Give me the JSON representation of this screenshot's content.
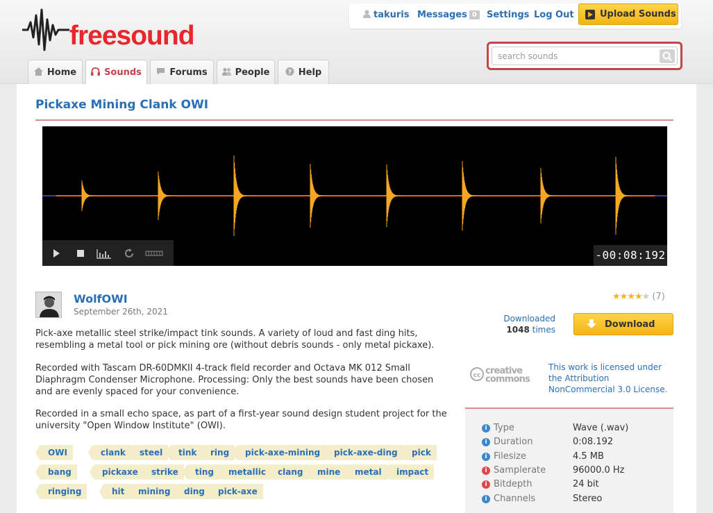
{
  "brand": {
    "name": "freesound",
    "accent": "#e8262c",
    "link_color": "#2a6fb5"
  },
  "user_bar": {
    "username": "takuris",
    "messages_label": "Messages",
    "messages_count": "0",
    "settings_label": "Settings",
    "logout_label": "Log Out",
    "upload_label": "Upload Sounds"
  },
  "search": {
    "placeholder": "search sounds",
    "value": ""
  },
  "nav": {
    "tabs": [
      {
        "label": "Home",
        "icon": "home-icon"
      },
      {
        "label": "Sounds",
        "icon": "headphones-icon",
        "active": true
      },
      {
        "label": "Forums",
        "icon": "speech-bubble-icon"
      },
      {
        "label": "People",
        "icon": "people-icon"
      },
      {
        "label": "Help",
        "icon": "help-icon"
      }
    ]
  },
  "sound": {
    "title": "Pickaxe Mining Clank OWI",
    "player": {
      "time": "-00:08:192"
    },
    "author": "WolfOWI",
    "date": "September 26th, 2021",
    "description": [
      "Pick-axe metallic steel strike/impact tink sounds. A variety of loud and fast ding hits, resembling a metal tool or pick mining ore (without debris sounds - only metal pickaxe).",
      "Recorded with Tascam DR-60DMKII 4-track field recorder and Octava MK 012 Small Diaphragm Condenser Microphone. Processing: Only the best sounds have been chosen and are evenly spaced for your convenience.",
      "Recorded in a small echo space, as part of a first-year sound design student project for the university \"Open Window Institute\" (OWI)."
    ],
    "tags": [
      "OWI",
      "clank",
      "steel",
      "tink",
      "ring",
      "pick-axe-mining",
      "pick-axe-ding",
      "pick",
      "bang",
      "pickaxe",
      "strike",
      "ting",
      "metallic",
      "clang",
      "mine",
      "metal",
      "impact",
      "ringing",
      "hit",
      "mining",
      "ding",
      "pick-axe"
    ],
    "rating": {
      "stars": 4,
      "max": 5,
      "count": "(7)"
    },
    "downloads": {
      "label": "Downloaded",
      "count": "1048",
      "suffix": "times"
    },
    "download_label": "Download",
    "license": {
      "logo_text_1": "creative",
      "logo_text_2": "commons",
      "text": "This work is licensed under the Attribution NonCommercial 3.0 License."
    },
    "properties": [
      {
        "label": "Type",
        "value": "Wave (.wav)",
        "icon": "info-icon"
      },
      {
        "label": "Duration",
        "value": "0:08.192",
        "icon": "info-icon"
      },
      {
        "label": "Filesize",
        "value": "4.5 MB",
        "icon": "info-icon"
      },
      {
        "label": "Samplerate",
        "value": "96000.0 Hz",
        "icon": "warning-icon"
      },
      {
        "label": "Bitdepth",
        "value": "24 bit",
        "icon": "warning-icon"
      },
      {
        "label": "Channels",
        "value": "Stereo",
        "icon": "info-icon"
      }
    ]
  }
}
